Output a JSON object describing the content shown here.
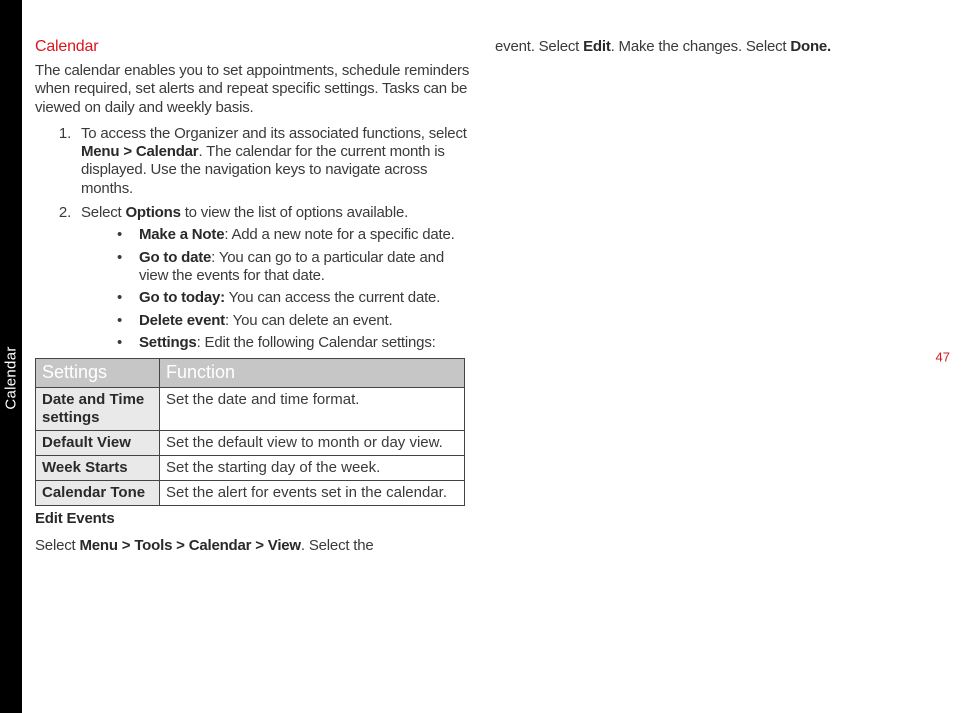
{
  "spine": {
    "label": "Calendar"
  },
  "page_number": "47",
  "heading": "Calendar",
  "intro": "The calendar enables you to set appointments, schedule reminders when required, set alerts and repeat specific settings. Tasks can be viewed on daily and weekly basis.",
  "step1": {
    "pre": "To access the Organizer and its associated functions, select ",
    "bold": "Menu > Calendar",
    "post": ". The calendar for the current month is displayed. Use the navigation keys to navigate across months."
  },
  "step2": {
    "pre": "Select ",
    "bold": "Options",
    "post": " to view the list of options available."
  },
  "options": [
    {
      "label": "Make a Note",
      "sep": ": ",
      "desc": "Add a new note for a specific date."
    },
    {
      "label": "Go to date",
      "sep": ": ",
      "desc": "You can go to a particular date and view the events for that date."
    },
    {
      "label": "Go to today:",
      "sep": " ",
      "desc": "You can access the current date."
    },
    {
      "label": "Delete event",
      "sep": ": ",
      "desc": "You can delete an event."
    },
    {
      "label": "Settings",
      "sep": ": ",
      "desc": "Edit the following Calendar settings:"
    }
  ],
  "table": {
    "headers": {
      "col1": "Settings",
      "col2": "Function"
    },
    "rows": [
      {
        "k": "Date and Time settings",
        "v": "Set the date and time format."
      },
      {
        "k": "Default View",
        "v": "Set the default view to month or day view."
      },
      {
        "k": "Week Starts",
        "v": "Set the starting day of the week."
      },
      {
        "k": "Calendar Tone",
        "v": "Set the alert for events set in the calendar."
      }
    ]
  },
  "edit_events_label": "Edit Events",
  "edit_events_line": {
    "pre": "Select ",
    "bold": "Menu > Tools > Calendar > View",
    "post": ". Select the"
  },
  "col2_line": {
    "pre": "event. Select ",
    "bold1": "Edit",
    "mid": ". Make the changes. Select ",
    "bold2": "Done."
  }
}
